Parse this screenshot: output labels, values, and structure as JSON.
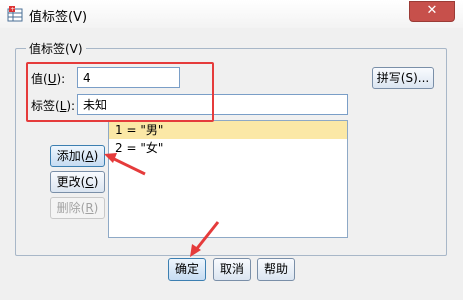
{
  "window": {
    "title": "值标签(V)",
    "close_label": "✕"
  },
  "group": {
    "label": "值标签(V)"
  },
  "value_field": {
    "label_prefix": "值(",
    "label_key": "U",
    "label_suffix": "):",
    "value": "4"
  },
  "label_field": {
    "label_prefix": "标签(",
    "label_key": "L",
    "label_suffix": "):",
    "value": "未知"
  },
  "spelling_button": "拼写(S)...",
  "list": {
    "items": [
      {
        "text": "1 = \"男\""
      },
      {
        "text": "2 = \"女\""
      }
    ]
  },
  "side_buttons": {
    "add_prefix": "添加(",
    "add_key": "A",
    "add_suffix": ")",
    "change_prefix": "更改(",
    "change_key": "C",
    "change_suffix": ")",
    "remove_prefix": "删除(",
    "remove_key": "R",
    "remove_suffix": ")"
  },
  "footer": {
    "ok": "确定",
    "cancel": "取消",
    "help": "帮助"
  },
  "colors": {
    "highlight": "#e53b3b",
    "selected_row": "#fbe8a6"
  }
}
